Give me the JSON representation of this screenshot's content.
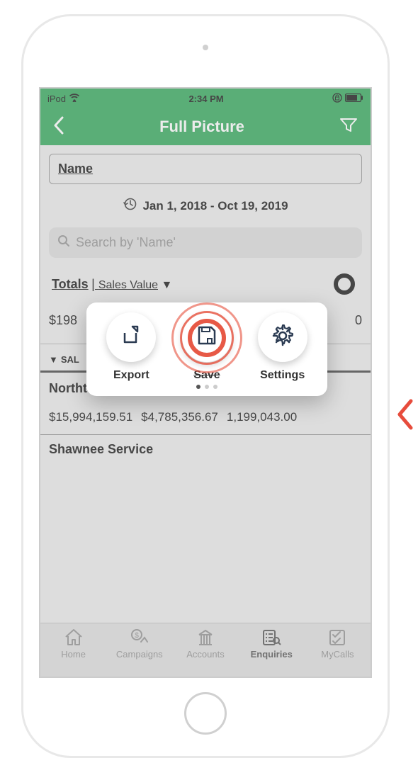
{
  "statusBar": {
    "device": "iPod",
    "time": "2:34 PM"
  },
  "navBar": {
    "title": "Full Picture"
  },
  "nameField": "Name",
  "dateRange": "Jan 1, 2018 - Oct 19, 2019",
  "searchPlaceholder": "Search by 'Name'",
  "totals": {
    "label": "Totals",
    "sub": "Sales Value"
  },
  "amountLeft": "$198",
  "amountRight": "0",
  "salesHeader": "SAL",
  "rows": [
    {
      "name": "Northtowne Auto Service",
      "v1": "$15,994,159.51",
      "v2": "$4,785,356.67",
      "v3": "1,199,043.00"
    },
    {
      "name": "Shawnee Service",
      "v1": "",
      "v2": "",
      "v3": ""
    }
  ],
  "popup": {
    "items": [
      {
        "label": "Export"
      },
      {
        "label": "Save"
      },
      {
        "label": "Settings"
      }
    ]
  },
  "tabs": [
    {
      "label": "Home"
    },
    {
      "label": "Campaigns"
    },
    {
      "label": "Accounts"
    },
    {
      "label": "Enquiries"
    },
    {
      "label": "MyCalls"
    }
  ]
}
